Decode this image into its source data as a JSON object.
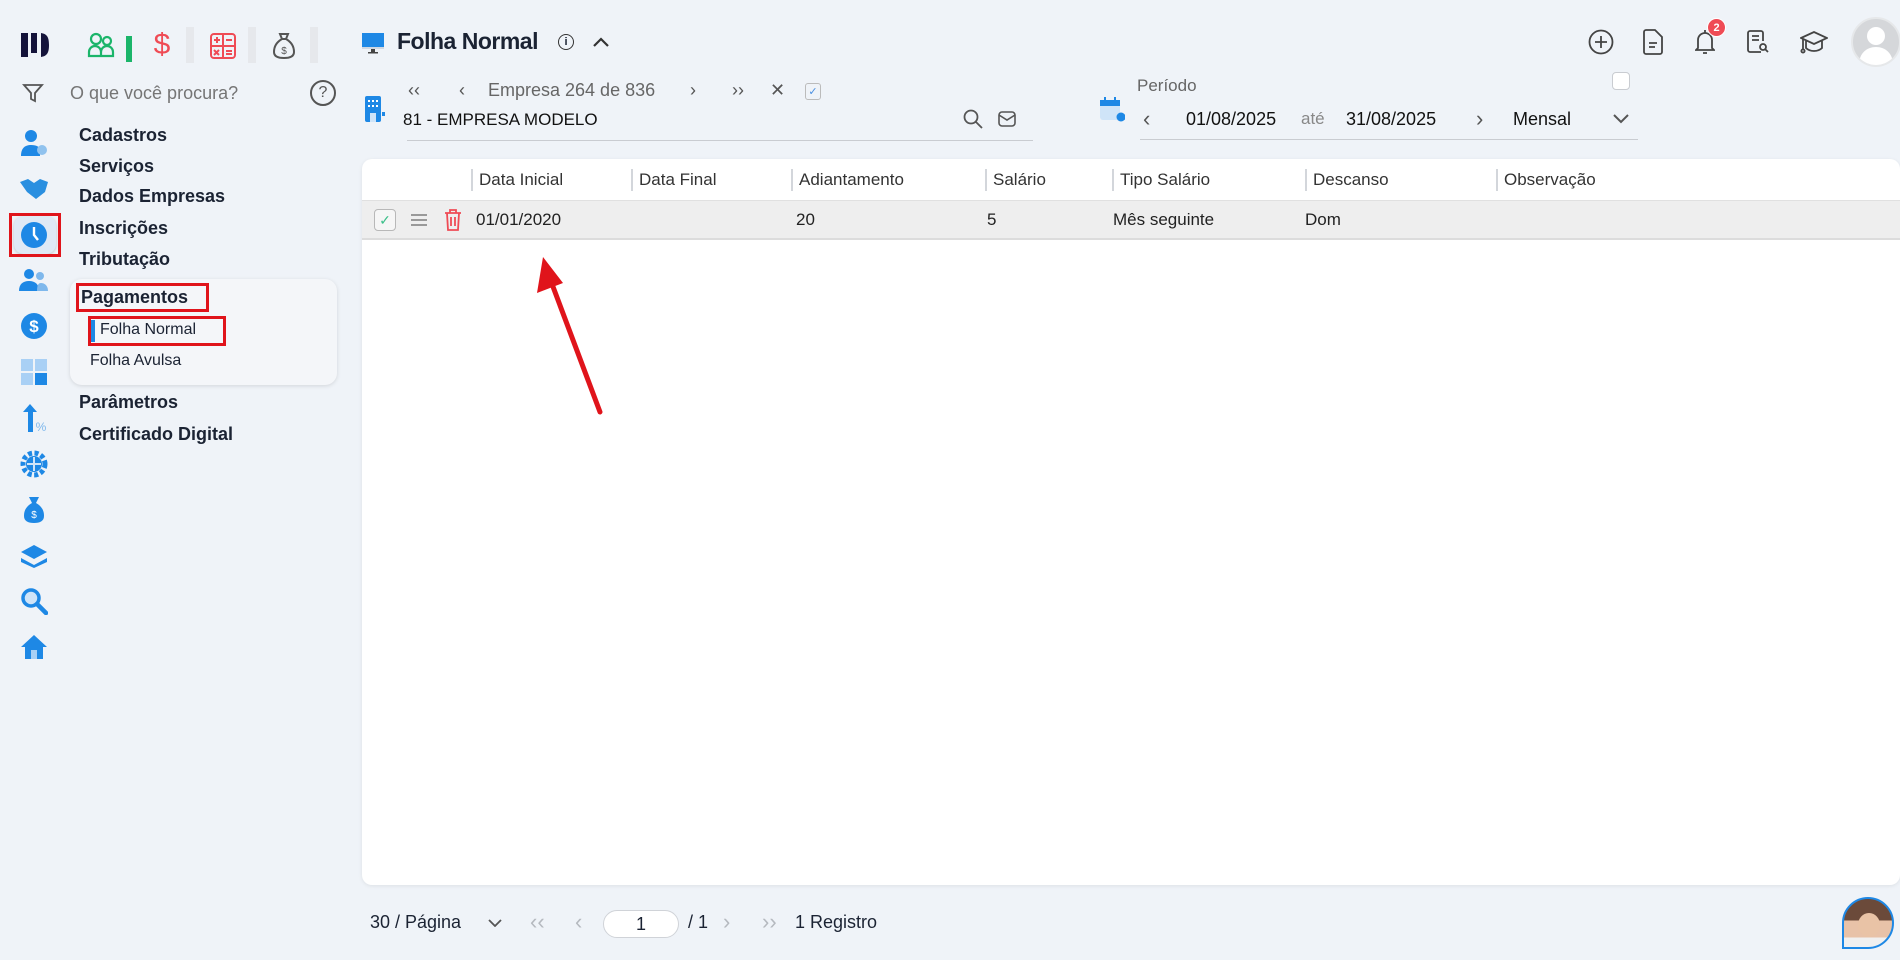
{
  "topbar_apps": [
    {
      "icon": "people-icon",
      "color": "#1bb56a"
    },
    {
      "icon": "dollar-icon",
      "color": "#ef4b55"
    },
    {
      "icon": "calculator-icon",
      "color": "#ef4b55"
    },
    {
      "icon": "money-bag-icon",
      "color": "#555555"
    }
  ],
  "search": {
    "placeholder": "O que você procura?"
  },
  "menu": {
    "items": [
      "Cadastros",
      "Serviços",
      "Dados Empresas",
      "Inscrições",
      "Tributação"
    ],
    "group": {
      "label": "Pagamentos",
      "children": [
        "Folha Normal",
        "Folha Avulsa"
      ],
      "active": "Folha Normal"
    },
    "items_after": [
      "Parâmetros",
      "Certificado Digital"
    ]
  },
  "rail_icons": [
    "user-settings-icon",
    "handshake-icon",
    "clock-icon",
    "users-icon",
    "dollar-circle-icon",
    "calculator-icon",
    "arrow-percent-icon",
    "gear-icon",
    "money-bag-icon",
    "layers-icon",
    "search-icon",
    "home-icon"
  ],
  "header": {
    "title": "Folha Normal"
  },
  "empresa": {
    "nav_text": "Empresa 264 de 836",
    "selected": "81 - EMPRESA MODELO",
    "checked": true
  },
  "periodo": {
    "label": "Período",
    "start": "01/08/2025",
    "separator": "até",
    "end": "31/08/2025",
    "mode": "Mensal"
  },
  "notifications": {
    "count": "2"
  },
  "table": {
    "columns": [
      "Data Inicial",
      "Data Final",
      "Adiantamento",
      "Salário",
      "Tipo Salário",
      "Descanso",
      "Observação"
    ],
    "rows": [
      {
        "data_inicial": "01/01/2020",
        "data_final": "",
        "adiantamento": "20",
        "salario": "5",
        "tipo_salario": "Mês seguinte",
        "descanso": "Dom",
        "observacao": ""
      }
    ]
  },
  "pagination": {
    "per_page": "30 / Página",
    "page": "1",
    "total_pages": "/ 1",
    "records": "1 Registro"
  },
  "colors": {
    "accent": "#1e88e5",
    "highlight": "#e0141b"
  }
}
